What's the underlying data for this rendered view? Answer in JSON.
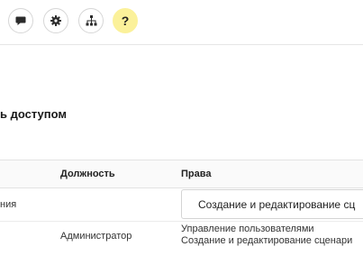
{
  "toolbar": {
    "buttons": [
      {
        "icon": "chat-icon"
      },
      {
        "icon": "gear-icon"
      },
      {
        "icon": "org-structure-icon"
      },
      {
        "icon": "help-icon",
        "label": "?"
      }
    ],
    "help_color": "#fbf19a"
  },
  "section": {
    "title": "ь доступом"
  },
  "table": {
    "headers": {
      "position": "Должность",
      "rights": "Права"
    },
    "rows": [
      {
        "name": "ния",
        "position": "",
        "rights_select_value": "Создание и редактирование сц"
      },
      {
        "name": "",
        "position": "Администратор",
        "rights": [
          "Управление пользователями",
          "Создание и редактирование сценари"
        ]
      }
    ]
  }
}
